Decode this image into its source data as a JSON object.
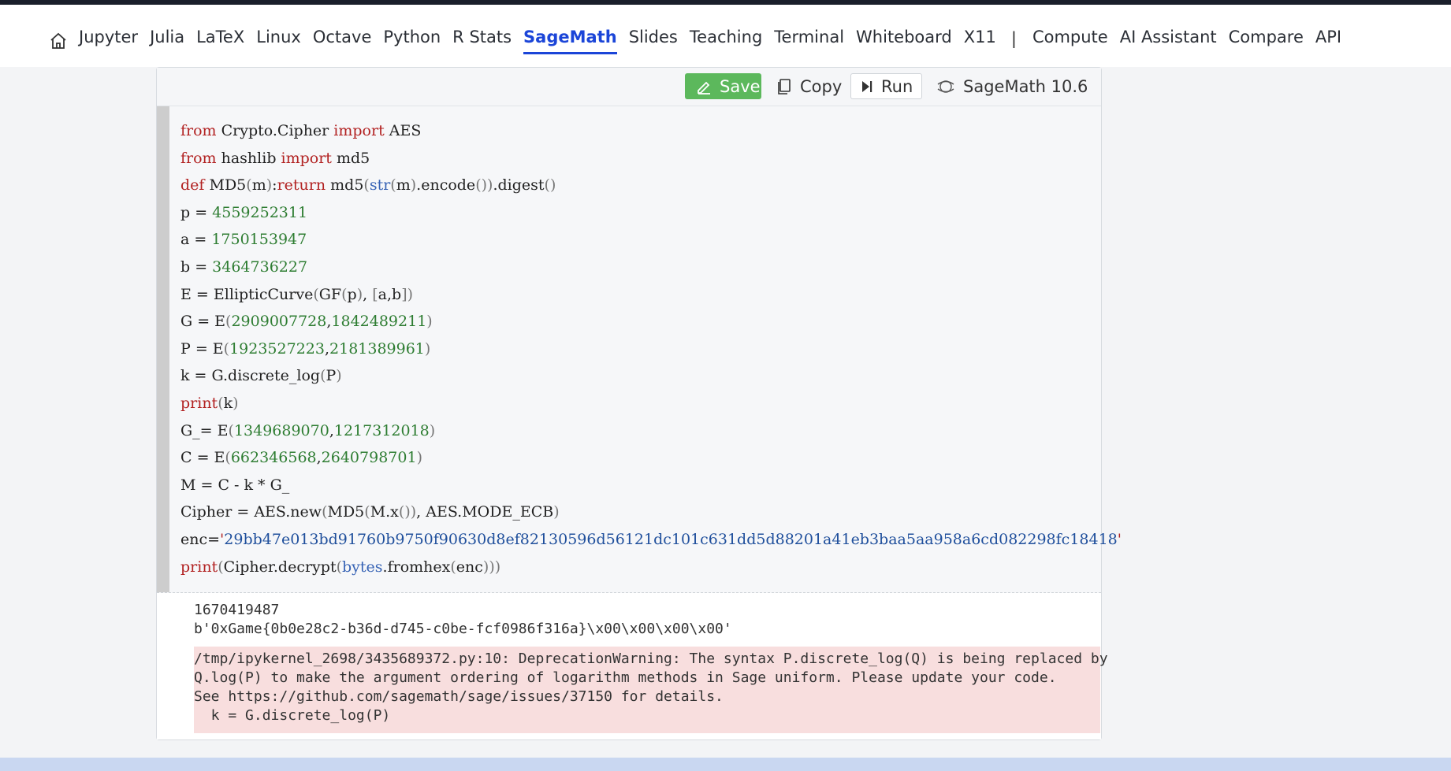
{
  "nav": {
    "home_icon": "home-icon",
    "items": [
      "Jupyter",
      "Julia",
      "LaTeX",
      "Linux",
      "Octave",
      "Python",
      "R Stats",
      "SageMath",
      "Slides",
      "Teaching",
      "Terminal",
      "Whiteboard",
      "X11"
    ],
    "active": "SageMath",
    "separator": "|",
    "right_items": [
      "Compute",
      "AI Assistant",
      "Compare",
      "API"
    ]
  },
  "toolbar": {
    "save_label": "Save",
    "copy_label": "Copy",
    "run_label": "Run",
    "kernel_label": "SageMath 10.6"
  },
  "code": {
    "lines": [
      "from Crypto.Cipher import AES",
      "from hashlib import md5",
      "def MD5(m):return md5(str(m).encode()).digest()",
      "p = 4559252311",
      "a = 1750153947",
      "b = 3464736227",
      "E = EllipticCurve(GF(p), [a,b])",
      "G = E(2909007728,1842489211)",
      "P = E(1923527223,2181389961)",
      "k = G.discrete_log(P)",
      "print(k)",
      "G_= E(1349689070,1217312018)",
      "C = E(662346568,2640798701)",
      "M = C - k * G_",
      "Cipher = AES.new(MD5(M.x()), AES.MODE_ECB)",
      "enc='29bb47e013bd91760b9750f90630d8ef82130596d56121dc101c631dd5d88201a41eb3baa5aa958a6cd082298fc18418'",
      "print(Cipher.decrypt(bytes.fromhex(enc)))"
    ]
  },
  "output": {
    "stdout_1": "1670419487",
    "stdout_2": "b'0xGame{0b0e28c2-b36d-d745-c0be-fcf0986f316a}\\x00\\x00\\x00\\x00'",
    "stderr_1": "/tmp/ipykernel_2698/3435689372.py:10: DeprecationWarning: The syntax P.discrete_log(Q) is being replaced by",
    "stderr_2": "Q.log(P) to make the argument ordering of logarithm methods in Sage uniform. Please update your code.",
    "stderr_3": "See https://github.com/sagemath/sage/issues/37150 for details.",
    "stderr_4": "  k = G.discrete_log(P)"
  },
  "colors": {
    "active_nav": "#1b45d8",
    "save_button": "#5cb85c",
    "error_bg": "#f8dede",
    "keyword": "#b22222",
    "number": "#2e7d32",
    "string": "#1f4f9c"
  }
}
